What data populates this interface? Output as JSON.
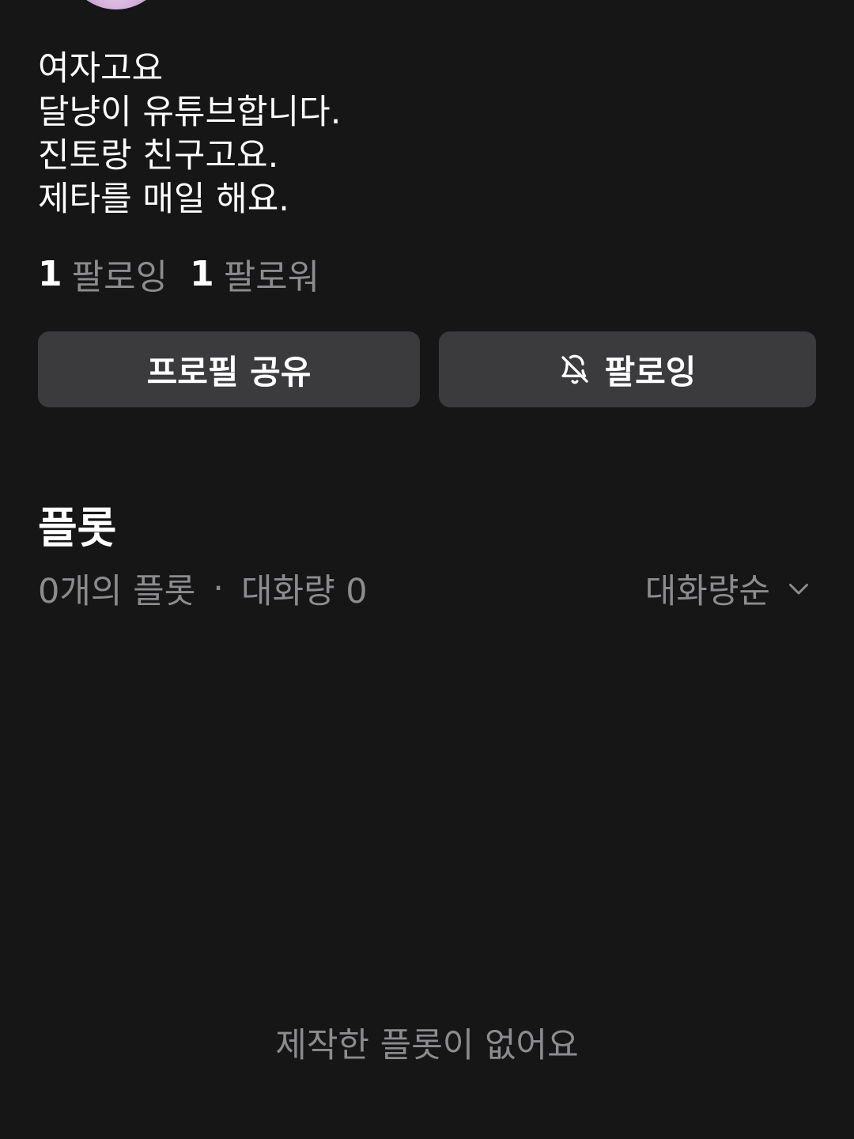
{
  "profile": {
    "bio_lines": [
      "여자고요",
      "달냥이 유튜브합니다.",
      "진토랑 친구고요.",
      "제타를 매일 해요."
    ]
  },
  "stats": {
    "following_count": "1",
    "following_label": "팔로잉",
    "follower_count": "1",
    "follower_label": "팔로워"
  },
  "actions": {
    "share_label": "프로필 공유",
    "follow_label": "팔로잉",
    "follow_icon": "bell-off-icon"
  },
  "plots": {
    "title": "플롯",
    "count_text": "0개의 플롯",
    "separator": "·",
    "volume_text": "대화량 0",
    "sort_label": "대화량순",
    "sort_icon": "chevron-down-icon",
    "empty_text": "제작한 플롯이 없어요"
  },
  "colors": {
    "background": "#161617",
    "button": "#3b3b3e",
    "muted_text": "#8c8c8f",
    "text": "#ffffff"
  }
}
